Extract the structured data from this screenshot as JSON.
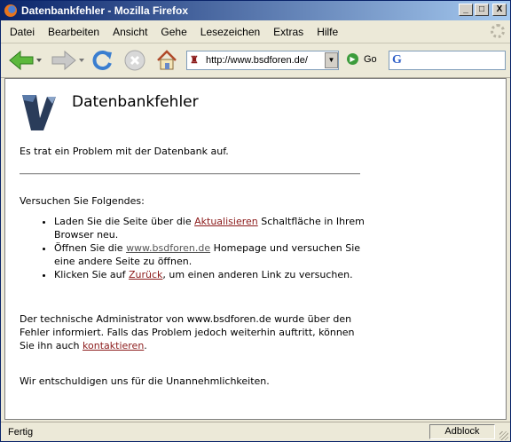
{
  "window": {
    "title": "Datenbankfehler - Mozilla Firefox",
    "minimize": "_",
    "maximize": "□",
    "close": "X"
  },
  "menu": [
    "Datei",
    "Bearbeiten",
    "Ansicht",
    "Gehe",
    "Lesezeichen",
    "Extras",
    "Hilfe"
  ],
  "nav": {
    "url": "http://www.bsdforen.de/",
    "go_label": "Go",
    "search_placeholder": ""
  },
  "page": {
    "heading": "Datenbankfehler",
    "intro": "Es trat ein Problem mit der Datenbank auf.",
    "try_heading": "Versuchen Sie Folgendes:",
    "item1_before": "Laden Sie die Seite über die ",
    "item1_link": "Aktualisieren",
    "item1_after": " Schaltfläche in Ihrem Browser neu.",
    "item2_before": "Öffnen Sie die ",
    "item2_link": "www.bsdforen.de",
    "item2_after": " Homepage und versuchen Sie eine andere Seite zu öffnen.",
    "item3_before": "Klicken Sie auf ",
    "item3_link": "Zurück",
    "item3_after": ", um einen anderen Link zu versuchen.",
    "admin_before": "Der technische Administrator von www.bsdforen.de wurde über den Fehler informiert. Falls das Problem jedoch weiterhin auftritt, können Sie ihn auch ",
    "admin_link": "kontaktieren",
    "admin_after": ".",
    "sorry": "Wir entschuldigen uns für die Unannehmlichkeiten."
  },
  "status": {
    "text": "Fertig",
    "adblock": "Adblock"
  }
}
